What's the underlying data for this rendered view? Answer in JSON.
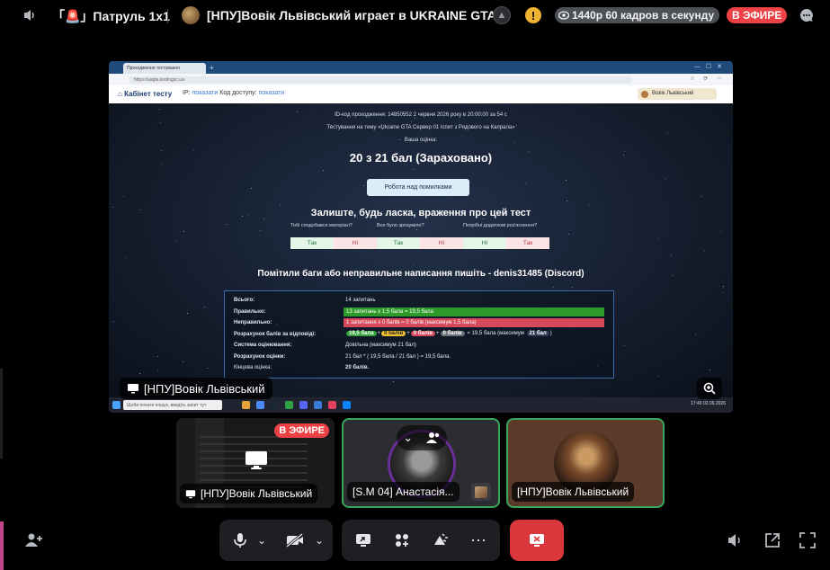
{
  "topbar": {
    "channel_name": "「🚨」Патруль 1x1",
    "stream_title": "[НПУ]Вовік Львівський играет в UKRAINE GTA",
    "quality": "1440p 60 кадров в секунду",
    "live_badge": "В ЭФИРЕ"
  },
  "stream": {
    "browser_tab": "Проходження тестування",
    "browser_url": "https://uagta.testingpc.ua",
    "site": {
      "brand": "Кабінет тесту",
      "ip_label": "IP:",
      "ip_link": "показати",
      "code_label": "Код доступу:",
      "code_link": "показати",
      "user": "Вовік Львівський"
    },
    "meta_line1": "ID-код проходження: 14850552  2 червня 2026 року в 20:00:00 за 54 с",
    "meta_line2": "Тестування на тему «Ukraine GTA Сервер 01 Іспит з Рядового на Капрала»",
    "meta_line3": "Ваша оцінка:",
    "score": "20 з 21 бал (Зараховано)",
    "review_button": "Робота над помилками",
    "feedback_title": "Залиште, будь ласка, враження про цей тест",
    "feedback": [
      {
        "question": "Тобі сподобався матеріал?",
        "opt1": "Так",
        "opt2": "Ні"
      },
      {
        "question": "Все було зрозуміло?",
        "opt1": "Так",
        "opt2": "Ні"
      },
      {
        "question": "Потрібні додаткові роз'яснення?",
        "opt1": "Ні",
        "opt2": "Так"
      }
    ],
    "bug_report": "Помітили баги або неправильне написання пишіть - denis31485 (Discord)",
    "results": {
      "total_label": "Всього:",
      "total_value": "14 запитань",
      "correct_label": "Правильно:",
      "correct_value": "13 запитань x 1,5 бала = 19,5 бала",
      "wrong_label": "Неправильно:",
      "wrong_value": "1 запитання x 0 балів = 0 балів (максимум 1,5 бала)",
      "calc_label": "Розрахунок балів за відповіді:",
      "calc_p1": "19,5 бала",
      "calc_p2": "0 балів",
      "calc_p3": "0 балів",
      "calc_p4": "0 балів",
      "calc_eq": "= 19,5 бала",
      "calc_max_label": "(максимум",
      "calc_max": "21 бал",
      "system_label": "Система оцінювання:",
      "system_value": "Довільна (максимум 21 бал)",
      "grade_label": "Розрахунок оцінки:",
      "grade_value": "21 бал * ( 19,5 бала / 21 бал ) = 19,5 бала.",
      "final_label": "Кінцева оцінка:",
      "final_value": "20 балів."
    },
    "taskbar_search": "Щоби почати пошук, введіть запит тут",
    "tray": "17:40  02.06.2026",
    "presenter_label": "[НПУ]Вовік Львівський"
  },
  "tiles": [
    {
      "label": "[НПУ]Вовік Львівський",
      "badge": "В ЭФИРЕ"
    },
    {
      "label": "[S.M 04] Анастасія..."
    },
    {
      "label": "[НПУ]Вовік Львівський"
    }
  ],
  "colors": {
    "live": "#ed4245",
    "speaking": "#3ba55d",
    "end_call": "#da373c",
    "warning": "#f0b232"
  }
}
